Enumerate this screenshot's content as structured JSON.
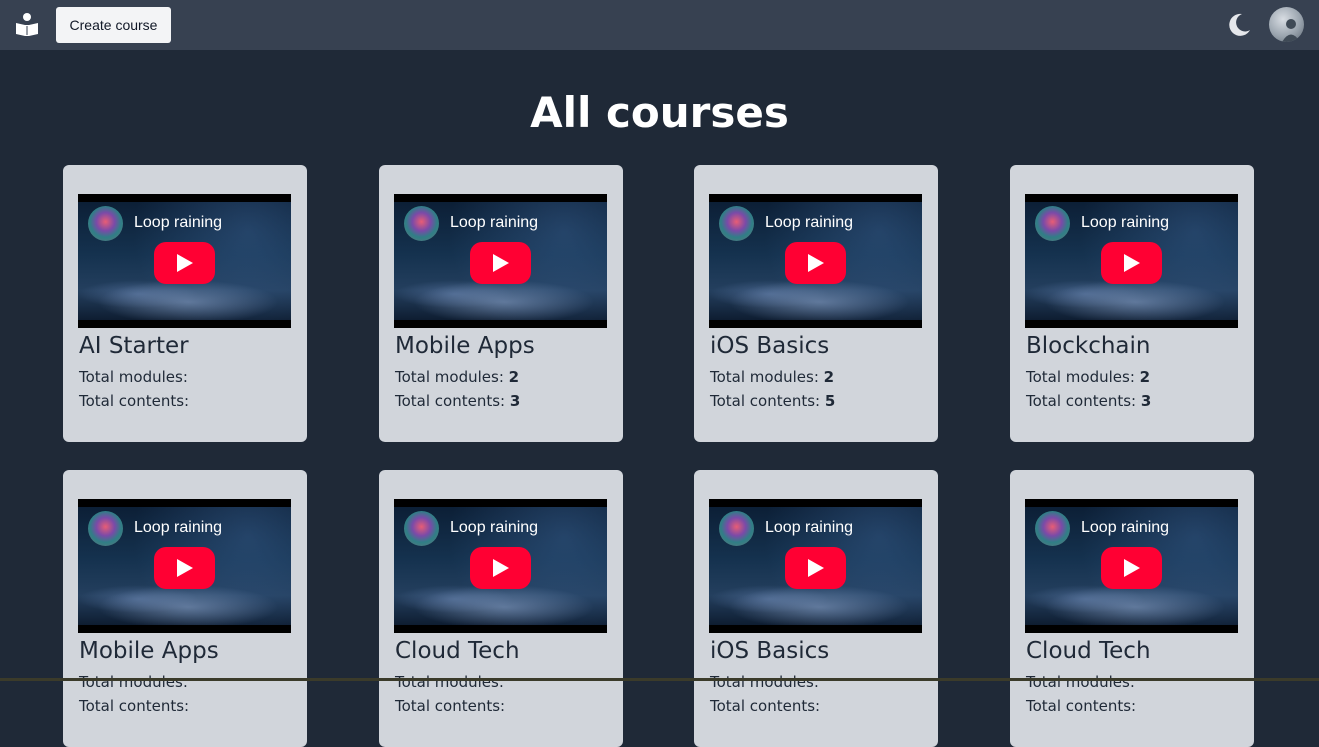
{
  "header": {
    "create_course_label": "Create course",
    "logo_icon": "reading-person-icon",
    "theme_icon": "moon-icon",
    "avatar_icon": "user-avatar"
  },
  "main": {
    "title": "All courses",
    "stat_labels": {
      "modules": "Total modules:",
      "contents": "Total contents:"
    },
    "courses": [
      {
        "title": "AI Starter",
        "modules": "",
        "contents": "",
        "video_title": "Loop raining"
      },
      {
        "title": "Mobile Apps",
        "modules": "2",
        "contents": "3",
        "video_title": "Loop raining"
      },
      {
        "title": "iOS Basics",
        "modules": "2",
        "contents": "5",
        "video_title": "Loop raining"
      },
      {
        "title": "Blockchain",
        "modules": "2",
        "contents": "3",
        "video_title": "Loop raining"
      },
      {
        "title": "Mobile Apps",
        "modules": "",
        "contents": "",
        "video_title": "Loop raining"
      },
      {
        "title": "Cloud Tech",
        "modules": "",
        "contents": "",
        "video_title": "Loop raining"
      },
      {
        "title": "iOS Basics",
        "modules": "",
        "contents": "",
        "video_title": "Loop raining"
      },
      {
        "title": "Cloud Tech",
        "modules": "",
        "contents": "",
        "video_title": "Loop raining"
      }
    ]
  },
  "colors": {
    "background": "#1f2937",
    "topbar": "#374151",
    "card": "#d1d5db",
    "youtube_red": "#ff0033"
  }
}
